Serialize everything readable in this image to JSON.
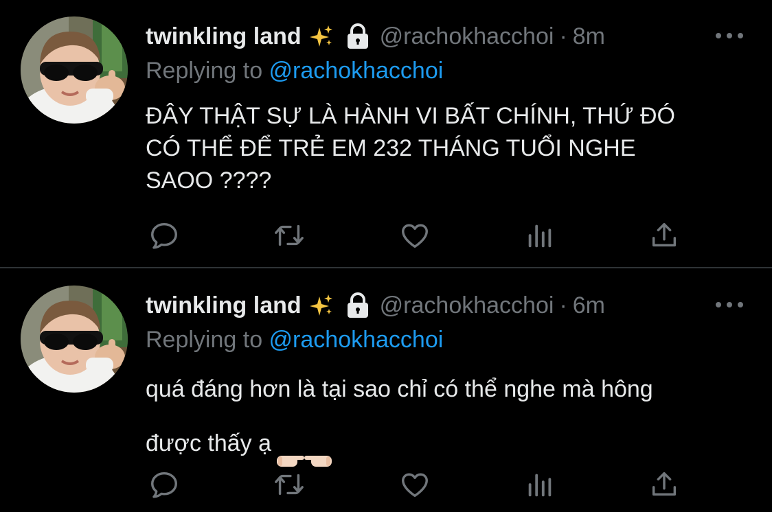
{
  "colors": {
    "background": "#000000",
    "text_primary": "#e7e9ea",
    "text_secondary": "#71767b",
    "link": "#1d9bf0",
    "divider": "#2f3336"
  },
  "tweets": [
    {
      "display_name": "twinkling land",
      "badge_icon": "sparkles-icon",
      "protected_icon": "lock-icon",
      "handle": "@rachokhacchoi",
      "separator": "·",
      "time": "8m",
      "replying_prefix": "Replying to ",
      "replying_to": "@rachokhacchoi",
      "text": "ĐÂY THẬT SỰ LÀ HÀNH VI BẤT CHÍNH, THỨ ĐÓ\nCÓ THỂ ĐỂ TRẺ EM 232 THÁNG TUỔI NGHE\nSAOO ????",
      "actions": [
        "reply-icon",
        "retweet-icon",
        "like-icon",
        "analytics-icon",
        "share-icon"
      ]
    },
    {
      "display_name": "twinkling land",
      "badge_icon": "sparkles-icon",
      "protected_icon": "lock-icon",
      "handle": "@rachokhacchoi",
      "separator": "·",
      "time": "6m",
      "replying_prefix": "Replying to ",
      "replying_to": "@rachokhacchoi",
      "text": "quá đáng hơn là tại sao chỉ có thể nghe mà hông\nđược thấy ạ",
      "trailing_emoji": "pointing-hands-emoji",
      "actions": [
        "reply-icon",
        "retweet-icon",
        "like-icon",
        "analytics-icon",
        "share-icon"
      ]
    }
  ]
}
